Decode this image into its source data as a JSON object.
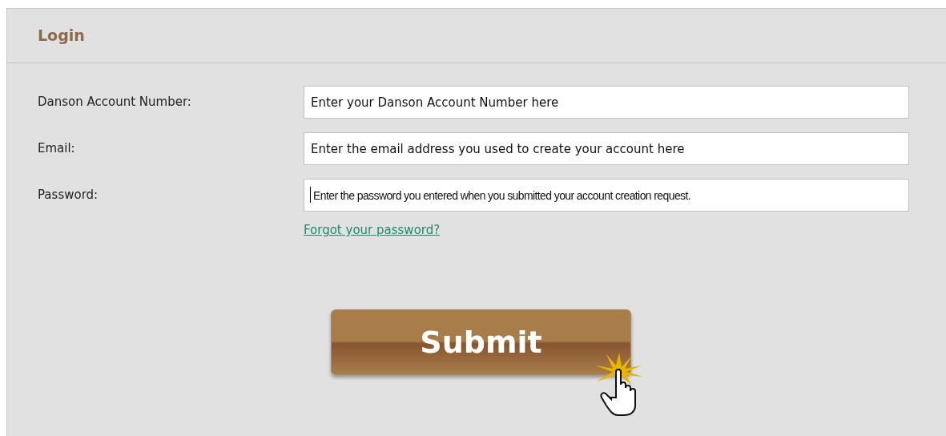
{
  "panel": {
    "title": "Login"
  },
  "fields": [
    {
      "label": "Danson Account Number:",
      "value": "Enter your Danson Account Number here",
      "kind": "text"
    },
    {
      "label": "Email:",
      "value": "Enter the email address you used to create your account here",
      "kind": "text"
    },
    {
      "label": "Password:",
      "value": "Enter the password you entered when you submitted your account creation request.",
      "kind": "focused"
    }
  ],
  "forgot_link": "Forgot your password?",
  "submit_button": "Submit"
}
